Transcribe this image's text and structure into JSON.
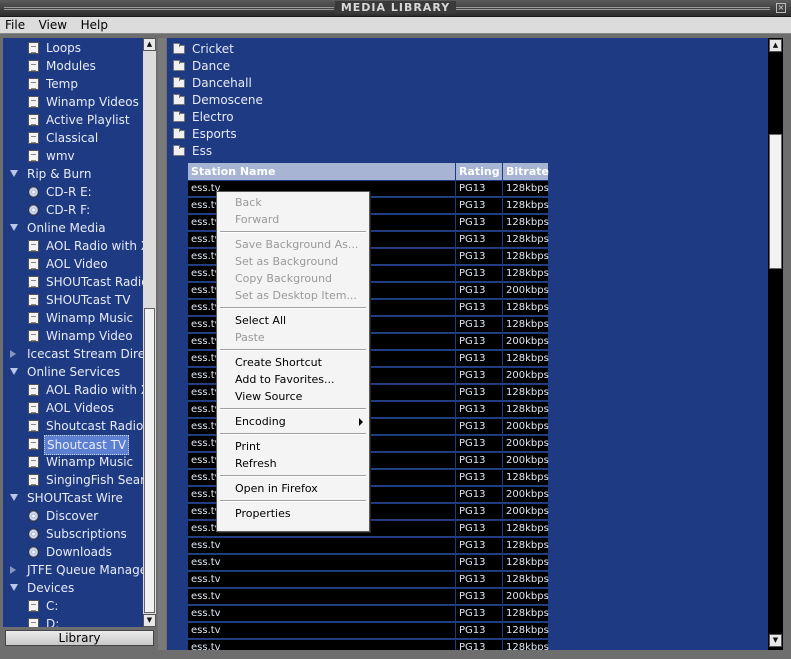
{
  "window": {
    "title": "MEDIA LIBRARY",
    "close_glyph": "×"
  },
  "menubar": [
    {
      "label": "File"
    },
    {
      "label": "View"
    },
    {
      "label": "Help"
    }
  ],
  "tree": [
    {
      "label": "Loops",
      "icon": "doc",
      "indent": 1
    },
    {
      "label": "Modules",
      "icon": "doc",
      "indent": 1
    },
    {
      "label": "Temp",
      "icon": "doc",
      "indent": 1
    },
    {
      "label": "Winamp Videos",
      "icon": "doc",
      "indent": 1
    },
    {
      "label": "Active Playlist",
      "icon": "doc",
      "indent": 1
    },
    {
      "label": "Classical",
      "icon": "doc",
      "indent": 1
    },
    {
      "label": "wmv",
      "icon": "doc",
      "indent": 1
    },
    {
      "label": "Rip & Burn",
      "icon": "expanded",
      "indent": 0
    },
    {
      "label": "CD-R E:",
      "icon": "disc",
      "indent": 1
    },
    {
      "label": "CD-R F:",
      "icon": "disc",
      "indent": 1
    },
    {
      "label": "Online Media",
      "icon": "expanded",
      "indent": 0
    },
    {
      "label": "AOL Radio with XM",
      "icon": "doc",
      "indent": 1
    },
    {
      "label": "AOL Video",
      "icon": "doc",
      "indent": 1
    },
    {
      "label": "SHOUTcast Radio",
      "icon": "doc",
      "indent": 1
    },
    {
      "label": "SHOUTcast TV",
      "icon": "doc",
      "indent": 1
    },
    {
      "label": "Winamp Music",
      "icon": "doc",
      "indent": 1
    },
    {
      "label": "Winamp Video",
      "icon": "doc",
      "indent": 1
    },
    {
      "label": "Icecast Stream Directory",
      "icon": "collapsed",
      "indent": 0
    },
    {
      "label": "Online Services",
      "icon": "expanded",
      "indent": 0
    },
    {
      "label": "AOL Radio with XM",
      "icon": "doc",
      "indent": 1
    },
    {
      "label": "AOL Videos",
      "icon": "doc",
      "indent": 1
    },
    {
      "label": "Shoutcast Radio",
      "icon": "doc",
      "indent": 1
    },
    {
      "label": "Shoutcast TV",
      "icon": "doc",
      "indent": 1,
      "selected": true
    },
    {
      "label": "Winamp Music",
      "icon": "doc",
      "indent": 1
    },
    {
      "label": "SingingFish Search",
      "icon": "doc",
      "indent": 1
    },
    {
      "label": "SHOUTcast Wire",
      "icon": "expanded",
      "indent": 0
    },
    {
      "label": "Discover",
      "icon": "disc",
      "indent": 1
    },
    {
      "label": "Subscriptions",
      "icon": "disc",
      "indent": 1
    },
    {
      "label": "Downloads",
      "icon": "disc",
      "indent": 1
    },
    {
      "label": "JTFE Queue Manageme",
      "icon": "collapsed",
      "indent": 0
    },
    {
      "label": "Devices",
      "icon": "expanded",
      "indent": 0
    },
    {
      "label": "C:",
      "icon": "doc",
      "indent": 1
    },
    {
      "label": "D:",
      "icon": "doc",
      "indent": 1
    }
  ],
  "library_button": "Library",
  "folders": [
    "Cricket",
    "Dance",
    "Dancehall",
    "Demoscene",
    "Electro",
    "Esports",
    "Ess"
  ],
  "grid": {
    "headers": [
      "Station Name",
      "Rating",
      "Bitrate"
    ],
    "rows": [
      [
        "ess.tv",
        "PG13",
        "128kbps"
      ],
      [
        "ess.tv",
        "PG13",
        "128kbps"
      ],
      [
        "ess.tv",
        "PG13",
        "128kbps"
      ],
      [
        "ess.tv",
        "PG13",
        "128kbps"
      ],
      [
        "ess.tv",
        "PG13",
        "128kbps"
      ],
      [
        "ess.tv",
        "PG13",
        "128kbps"
      ],
      [
        "ess.tv",
        "PG13",
        "200kbps"
      ],
      [
        "ess.tv",
        "PG13",
        "128kbps"
      ],
      [
        "ess.tv",
        "PG13",
        "128kbps"
      ],
      [
        "ess.tv",
        "PG13",
        "200kbps"
      ],
      [
        "ess.tv",
        "PG13",
        "128kbps"
      ],
      [
        "ess.tv",
        "PG13",
        "200kbps"
      ],
      [
        "ess.tv",
        "PG13",
        "128kbps"
      ],
      [
        "ess.tv",
        "PG13",
        "128kbps"
      ],
      [
        "ess.tv",
        "PG13",
        "200kbps"
      ],
      [
        "ess.tv",
        "PG13",
        "200kbps"
      ],
      [
        "ess.tv",
        "PG13",
        "200kbps"
      ],
      [
        "ess.tv",
        "PG13",
        "128kbps"
      ],
      [
        "ess.tv",
        "PG13",
        "200kbps"
      ],
      [
        "ess.tv",
        "PG13",
        "200kbps"
      ],
      [
        "ess.tv",
        "PG13",
        "128kbps"
      ],
      [
        "ess.tv",
        "PG13",
        "128kbps"
      ],
      [
        "ess.tv",
        "PG13",
        "128kbps"
      ],
      [
        "ess.tv",
        "PG13",
        "128kbps"
      ],
      [
        "ess.tv",
        "PG13",
        "200kbps"
      ],
      [
        "ess.tv",
        "PG13",
        "128kbps"
      ],
      [
        "ess.tv",
        "PG13",
        "128kbps"
      ],
      [
        "ess.tv",
        "PG13",
        "128kbps"
      ]
    ]
  },
  "context_menu": [
    {
      "label": "Back",
      "disabled": true
    },
    {
      "label": "Forward",
      "disabled": true
    },
    {
      "sep": true
    },
    {
      "label": "Save Background As...",
      "disabled": true
    },
    {
      "label": "Set as Background",
      "disabled": true
    },
    {
      "label": "Copy Background",
      "disabled": true
    },
    {
      "label": "Set as Desktop Item...",
      "disabled": true
    },
    {
      "sep": true
    },
    {
      "label": "Select All",
      "disabled": false
    },
    {
      "label": "Paste",
      "disabled": true
    },
    {
      "sep": true
    },
    {
      "label": "Create Shortcut",
      "disabled": false
    },
    {
      "label": "Add to Favorites...",
      "disabled": false
    },
    {
      "label": "View Source",
      "disabled": false
    },
    {
      "sep": true
    },
    {
      "label": "Encoding",
      "disabled": false,
      "submenu": true
    },
    {
      "sep": true
    },
    {
      "label": "Print",
      "disabled": false
    },
    {
      "label": "Refresh",
      "disabled": false
    },
    {
      "sep": true
    },
    {
      "label": "Open in Firefox",
      "disabled": false
    },
    {
      "sep": true
    },
    {
      "label": "Properties",
      "disabled": false
    }
  ]
}
